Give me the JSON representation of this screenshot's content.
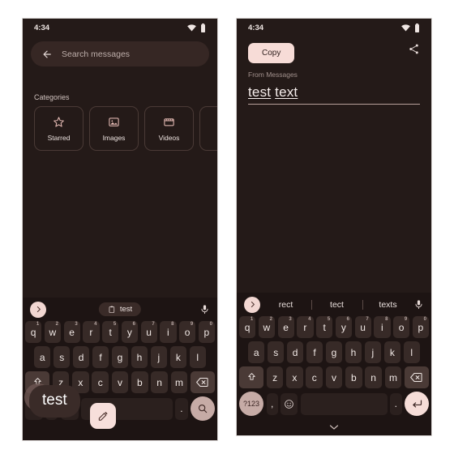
{
  "left_phone": {
    "status_bar": {
      "time": "4:34",
      "wifi_icon": "wifi-icon",
      "battery_icon": "battery-icon"
    },
    "search": {
      "back_icon": "back-arrow-icon",
      "placeholder": "Search messages",
      "value": ""
    },
    "categories": {
      "heading": "Categories",
      "items": [
        {
          "label": "Starred",
          "icon": "star-icon"
        },
        {
          "label": "Images",
          "icon": "image-icon"
        },
        {
          "label": "Videos",
          "icon": "video-icon"
        },
        {
          "label": "",
          "icon": ""
        }
      ]
    },
    "keyboard": {
      "expand_icon": "chevron-right-icon",
      "clipboard_chip": {
        "label": "test",
        "icon": "clipboard-icon"
      },
      "mic_icon": "microphone-icon",
      "row1": [
        {
          "key": "q",
          "num": "1"
        },
        {
          "key": "w",
          "num": "2"
        },
        {
          "key": "e",
          "num": "3"
        },
        {
          "key": "r",
          "num": "4"
        },
        {
          "key": "t",
          "num": "5"
        },
        {
          "key": "y",
          "num": "6"
        },
        {
          "key": "u",
          "num": "7"
        },
        {
          "key": "i",
          "num": "8"
        },
        {
          "key": "o",
          "num": "9"
        },
        {
          "key": "p",
          "num": "0"
        }
      ],
      "row2": [
        "a",
        "s",
        "d",
        "f",
        "g",
        "h",
        "j",
        "k",
        "l"
      ],
      "row3": [
        "z",
        "x",
        "c",
        "v",
        "b",
        "n",
        "m"
      ],
      "shift_icon": "shift-icon",
      "backspace_icon": "backspace-icon",
      "emoji_icon": "emoji-icon",
      "period_key": ".",
      "action_icon": "search-icon"
    },
    "paste_popup": {
      "text": "test",
      "edit_icon": "pencil-icon"
    }
  },
  "right_phone": {
    "status_bar": {
      "time": "4:34",
      "wifi_icon": "wifi-icon",
      "battery_icon": "battery-icon"
    },
    "copy_label": "Copy",
    "share_icon": "share-icon",
    "from_label": "From Messages",
    "edit_value_part1": "test",
    "edit_value_part2": "text",
    "keyboard": {
      "expand_icon": "chevron-right-icon",
      "suggestions": [
        "rect",
        "tect",
        "texts"
      ],
      "mic_icon": "microphone-icon",
      "row1": [
        {
          "key": "q",
          "num": "1"
        },
        {
          "key": "w",
          "num": "2"
        },
        {
          "key": "e",
          "num": "3"
        },
        {
          "key": "r",
          "num": "4"
        },
        {
          "key": "t",
          "num": "5"
        },
        {
          "key": "y",
          "num": "6"
        },
        {
          "key": "u",
          "num": "7"
        },
        {
          "key": "i",
          "num": "8"
        },
        {
          "key": "o",
          "num": "9"
        },
        {
          "key": "p",
          "num": "0"
        }
      ],
      "row2": [
        "a",
        "s",
        "d",
        "f",
        "g",
        "h",
        "j",
        "k",
        "l"
      ],
      "row3": [
        "z",
        "x",
        "c",
        "v",
        "b",
        "n",
        "m"
      ],
      "shift_icon": "shift-icon",
      "backspace_icon": "backspace-icon",
      "symbols_key": "?123",
      "comma_key": ",",
      "emoji_icon": "emoji-icon",
      "period_key": ".",
      "enter_icon": "enter-icon",
      "hide_keyboard_icon": "chevron-down-icon"
    }
  },
  "colors": {
    "background": "#241a18",
    "keyboard_bg": "#1d1413",
    "key": "#372a27",
    "accent_pink": "#f7dcd7",
    "accent_muted": "#c6aba6",
    "text": "#f0e8e5"
  }
}
